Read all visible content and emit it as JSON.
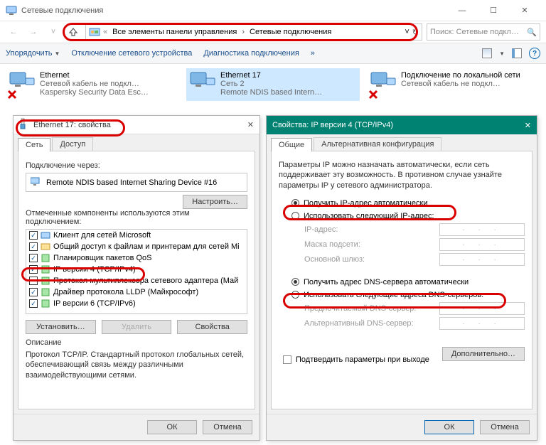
{
  "window": {
    "title": "Сетевые подключения",
    "controls": {
      "min": "—",
      "max": "☐",
      "close": "✕"
    }
  },
  "nav": {
    "back": "←",
    "fwd": "→",
    "up_desc": "up"
  },
  "breadcrumb": {
    "lead": "«",
    "seg1": "Все элементы панели управления",
    "seg2": "Сетевые подключения",
    "dropdown_hint": "˅",
    "refresh_hint": "↻"
  },
  "search": {
    "placeholder": "Поиск: Сетевые подкл…",
    "icon_hint": "🔍"
  },
  "toolbar": {
    "organize": "Упорядочить",
    "disable": "Отключение сетевого устройства",
    "diag": "Диагностика подключения",
    "more": "»"
  },
  "connections": [
    {
      "title": "Ethernet",
      "sub1": "Сетевой кабель не подкл…",
      "sub2": "Kaspersky Security Data Esc…",
      "selected": false,
      "cross": true
    },
    {
      "title": "Ethernet 17",
      "sub1": "Сеть 2",
      "sub2": "Remote NDIS based Intern…",
      "selected": true,
      "cross": false
    },
    {
      "title": "Подключение по локальной сети",
      "sub1": "Сетевой кабель не подкл…",
      "sub2": "",
      "selected": false,
      "cross": true
    }
  ],
  "props_dlg": {
    "title_prefix": "Ethernet 17: свойства",
    "tab_net": "Сеть",
    "tab_access": "Доступ",
    "connect_via": "Подключение через:",
    "adapter": "Remote NDIS based Internet Sharing Device #16",
    "configure_btn": "Настроить…",
    "components_lbl": "Отмеченные компоненты используются этим подключением:",
    "components": [
      "Клиент для сетей Microsoft",
      "Общий доступ к файлам и принтерам для сетей Mi",
      "Планировщик пакетов QoS",
      "IP версии 4 (TCP/IPv4)",
      "Протокол мультиплексора сетевого адаптера (Май",
      "Драйвер протокола LLDP (Майкрософт)",
      "IP версии 6 (TCP/IPv6)"
    ],
    "components_checked": [
      true,
      true,
      true,
      true,
      false,
      true,
      true
    ],
    "install_btn": "Установить…",
    "remove_btn": "Удалить",
    "props_btn": "Свойства",
    "desc_lbl": "Описание",
    "desc_text": "Протокол TCP/IP. Стандартный протокол глобальных сетей, обеспечивающий связь между различными взаимодействующими сетями.",
    "ok": "ОК",
    "cancel": "Отмена"
  },
  "ipv4_dlg": {
    "title": "Свойства: IP версии 4 (TCP/IPv4)",
    "close": "✕",
    "tab_general": "Общие",
    "tab_alt": "Альтернативная конфигурация",
    "intro": "Параметры IP можно назначать автоматически, если сеть поддерживает эту возможность. В противном случае узнайте параметры IP у сетевого администратора.",
    "auto_ip": "Получить IP-адрес автоматически",
    "manual_ip": "Использовать следующий IP-адрес:",
    "ip_lbl": "IP-адрес:",
    "mask_lbl": "Маска подсети:",
    "gw_lbl": "Основной шлюз:",
    "auto_dns": "Получить адрес DNS-сервера автоматически",
    "manual_dns": "Использовать следующие адреса DNS-серверов:",
    "dns1_lbl": "Предпочитаемый DNS-сервер:",
    "dns2_lbl": "Альтернативный DNS-сервер:",
    "dots": ".     .     .",
    "validate": "Подтвердить параметры при выходе",
    "advanced": "Дополнительно…",
    "ok": "ОК",
    "cancel": "Отмена"
  }
}
